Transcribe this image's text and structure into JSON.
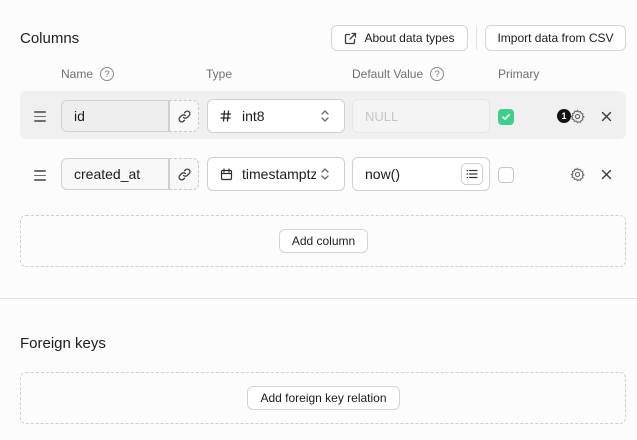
{
  "columns_section": {
    "title": "Columns",
    "about_button": "About data types",
    "import_button": "Import data from CSV",
    "headers": {
      "name": "Name",
      "type": "Type",
      "default_value": "Default Value",
      "primary": "Primary",
      "help": "?"
    },
    "add_column_button": "Add column"
  },
  "rows": [
    {
      "name": "id",
      "type": "int8",
      "type_icon": "hash-icon",
      "default_placeholder": "NULL",
      "primary": true,
      "badge": "1"
    },
    {
      "name": "created_at",
      "type": "timestamptz",
      "type_icon": "calendar-icon",
      "default_value": "now()",
      "primary": false
    }
  ],
  "foreign_keys_section": {
    "title": "Foreign keys",
    "add_button": "Add foreign key relation"
  },
  "colors": {
    "accent": "#3ecf8e",
    "row_highlight": "#f0f0f0",
    "border": "#d0d0d0"
  }
}
